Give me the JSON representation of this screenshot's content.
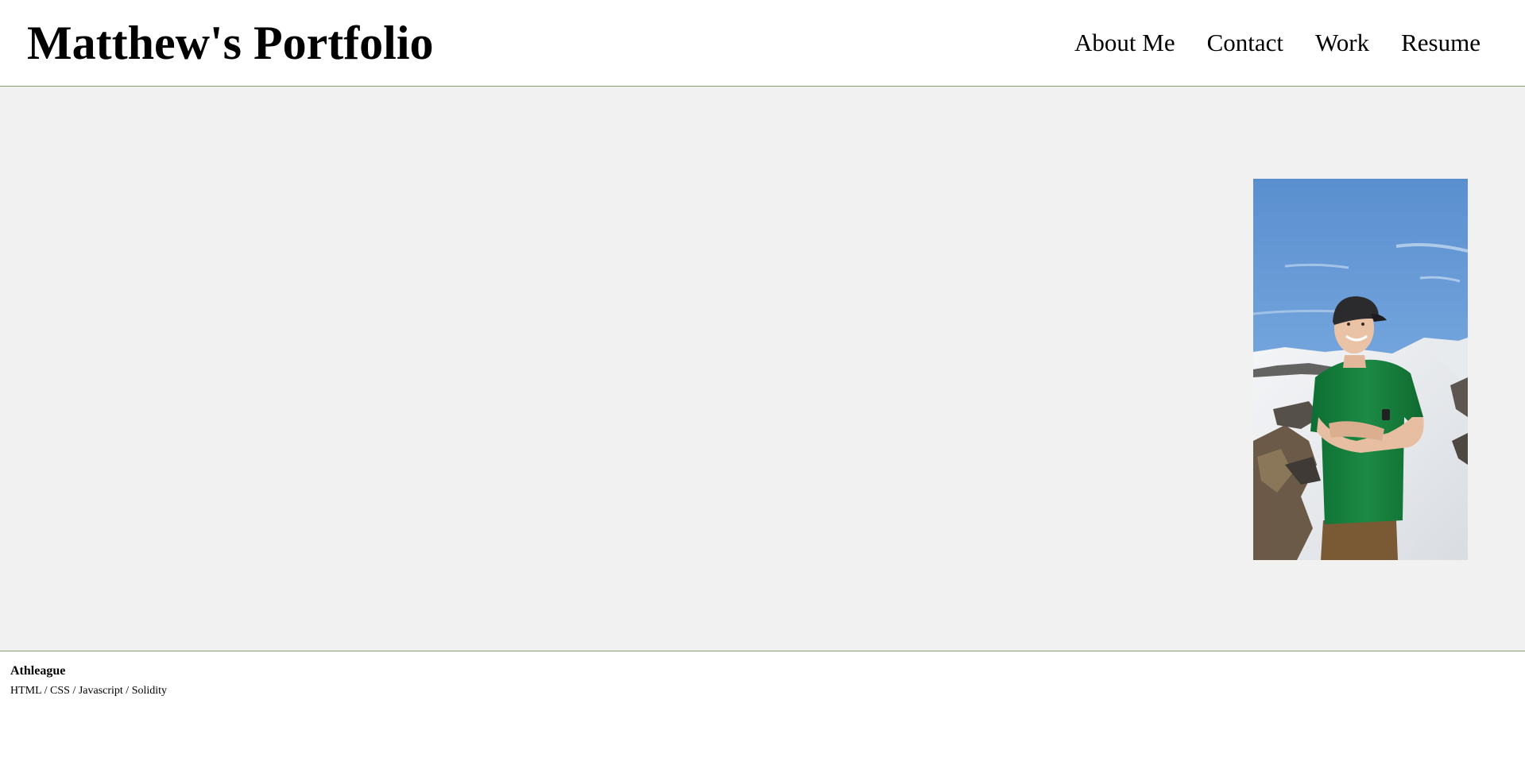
{
  "header": {
    "title": "Matthew's Portfolio",
    "nav": [
      {
        "label": "About Me"
      },
      {
        "label": "Contact"
      },
      {
        "label": "Work"
      },
      {
        "label": "Resume"
      }
    ]
  },
  "hero": {
    "photo_alt": "Matthew standing on a snowy mountain"
  },
  "project": {
    "name": "Athleague",
    "stack": "HTML / CSS / Javascript / Solidity"
  },
  "colors": {
    "header_bg": "#ffffff",
    "hero_bg": "#f1f1f1",
    "divider": "#7f9f73",
    "text": "#000000"
  }
}
